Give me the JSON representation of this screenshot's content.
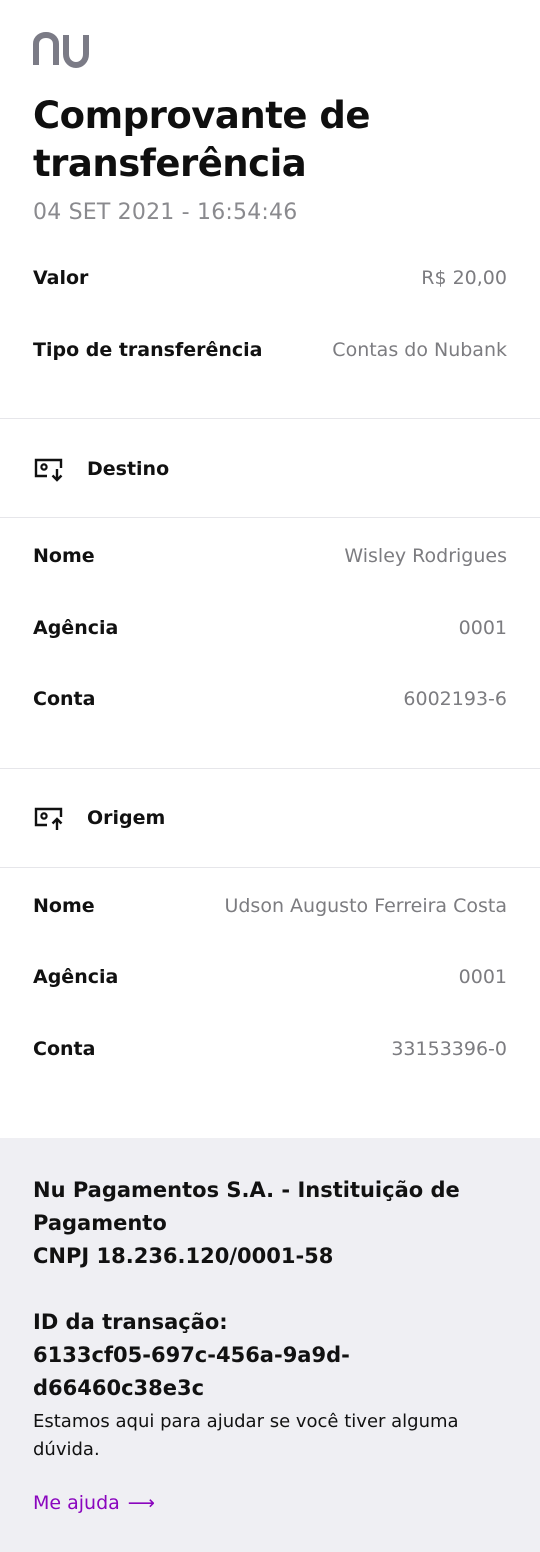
{
  "brand": {
    "logo_text": "nu",
    "accent_color": "#8a05be",
    "logo_color": "#7b7b86"
  },
  "header": {
    "title": "Comprovante de transferência",
    "datetime": "04 SET 2021 - 16:54:46"
  },
  "summary": {
    "valor_label": "Valor",
    "valor_value": "R$ 20,00",
    "tipo_label": "Tipo de transferência",
    "tipo_value": "Contas do Nubank"
  },
  "destino": {
    "title": "Destino",
    "icon": "account-in-icon",
    "nome_label": "Nome",
    "nome_value": "Wisley Rodrigues",
    "agencia_label": "Agência",
    "agencia_value": "0001",
    "conta_label": "Conta",
    "conta_value": "6002193-6"
  },
  "origem": {
    "title": "Origem",
    "icon": "account-out-icon",
    "nome_label": "Nome",
    "nome_value": "Udson Augusto Ferreira Costa",
    "agencia_label": "Agência",
    "agencia_value": "0001",
    "conta_label": "Conta",
    "conta_value": "33153396-0"
  },
  "footer": {
    "company": "Nu Pagamentos S.A. - Instituição de Pagamento",
    "cnpj": "CNPJ 18.236.120/0001-58",
    "transaction_label": "ID da transação:",
    "transaction_id": "6133cf05-697c-456a-9a9d-d66460c38e3c",
    "help_text": "Estamos aqui para ajudar se você tiver alguma dúvida.",
    "help_link": "Me ajuda",
    "help_arrow": "⟶"
  }
}
